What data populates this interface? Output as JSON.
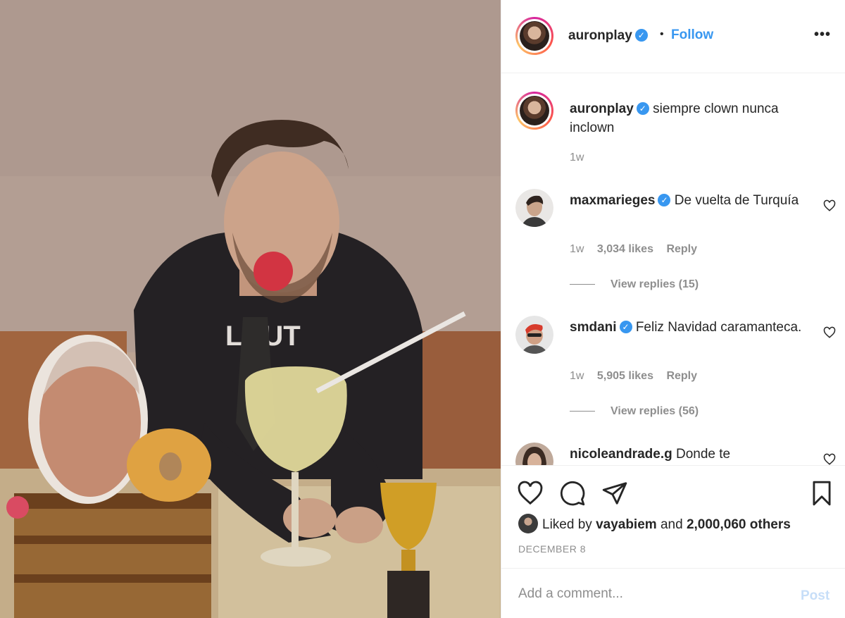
{
  "post": {
    "author": "auronplay",
    "follow_label": "Follow",
    "separator": "•",
    "more_label": "•••",
    "verified_mark": "✓",
    "photo_shirt_text": "LCUT"
  },
  "caption": {
    "user": "auronplay",
    "text": "siempre clown nunca inclown",
    "time": "1w"
  },
  "comments": [
    {
      "user": "maxmarieges",
      "verified": true,
      "text": "De vuelta de Turquía",
      "time": "1w",
      "likes": "3,034 likes",
      "reply_label": "Reply",
      "view_replies": "View replies (15)"
    },
    {
      "user": "smdani",
      "verified": true,
      "text": "Feliz Navidad caramanteca.",
      "time": "1w",
      "likes": "5,905 likes",
      "reply_label": "Reply",
      "view_replies": "View replies (56)"
    },
    {
      "user": "nicoleandrade.g",
      "verified": false,
      "text": "Donde te"
    }
  ],
  "actions": {
    "like_icon": "heart-icon",
    "comment_icon": "comment-icon",
    "share_icon": "paper-plane-icon",
    "save_icon": "bookmark-icon"
  },
  "likes_summary": {
    "prefix": "Liked by",
    "user": "vayabiem",
    "conjunction": "and",
    "others": "2,000,060 others"
  },
  "date": "DECEMBER 8",
  "add_comment": {
    "placeholder": "Add a comment...",
    "post_label": "Post"
  },
  "colors": {
    "link_blue": "#3897f0",
    "post_disabled": "#c7def8",
    "meta_gray": "#8e8e8e"
  }
}
